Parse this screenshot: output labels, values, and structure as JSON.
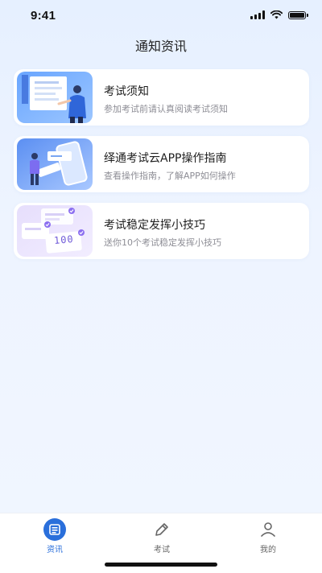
{
  "status_bar": {
    "time": "9:41"
  },
  "nav": {
    "title": "通知资讯"
  },
  "cards": [
    {
      "title": "考试须知",
      "subtitle": "参加考试前请认真阅读考试须知"
    },
    {
      "title": "绎通考试云APP操作指南",
      "subtitle": "查看操作指南，了解APP如何操作"
    },
    {
      "title": "考试稳定发挥小技巧",
      "subtitle": "送你10个考试稳定发挥小技巧",
      "thumb_text": "100"
    }
  ],
  "tabs": [
    {
      "label": "资讯",
      "icon": "news-icon",
      "active": true
    },
    {
      "label": "考试",
      "icon": "pen-icon",
      "active": false
    },
    {
      "label": "我的",
      "icon": "person-icon",
      "active": false
    }
  ],
  "colors": {
    "accent": "#2a6fdb",
    "background": "#eef4ff"
  }
}
